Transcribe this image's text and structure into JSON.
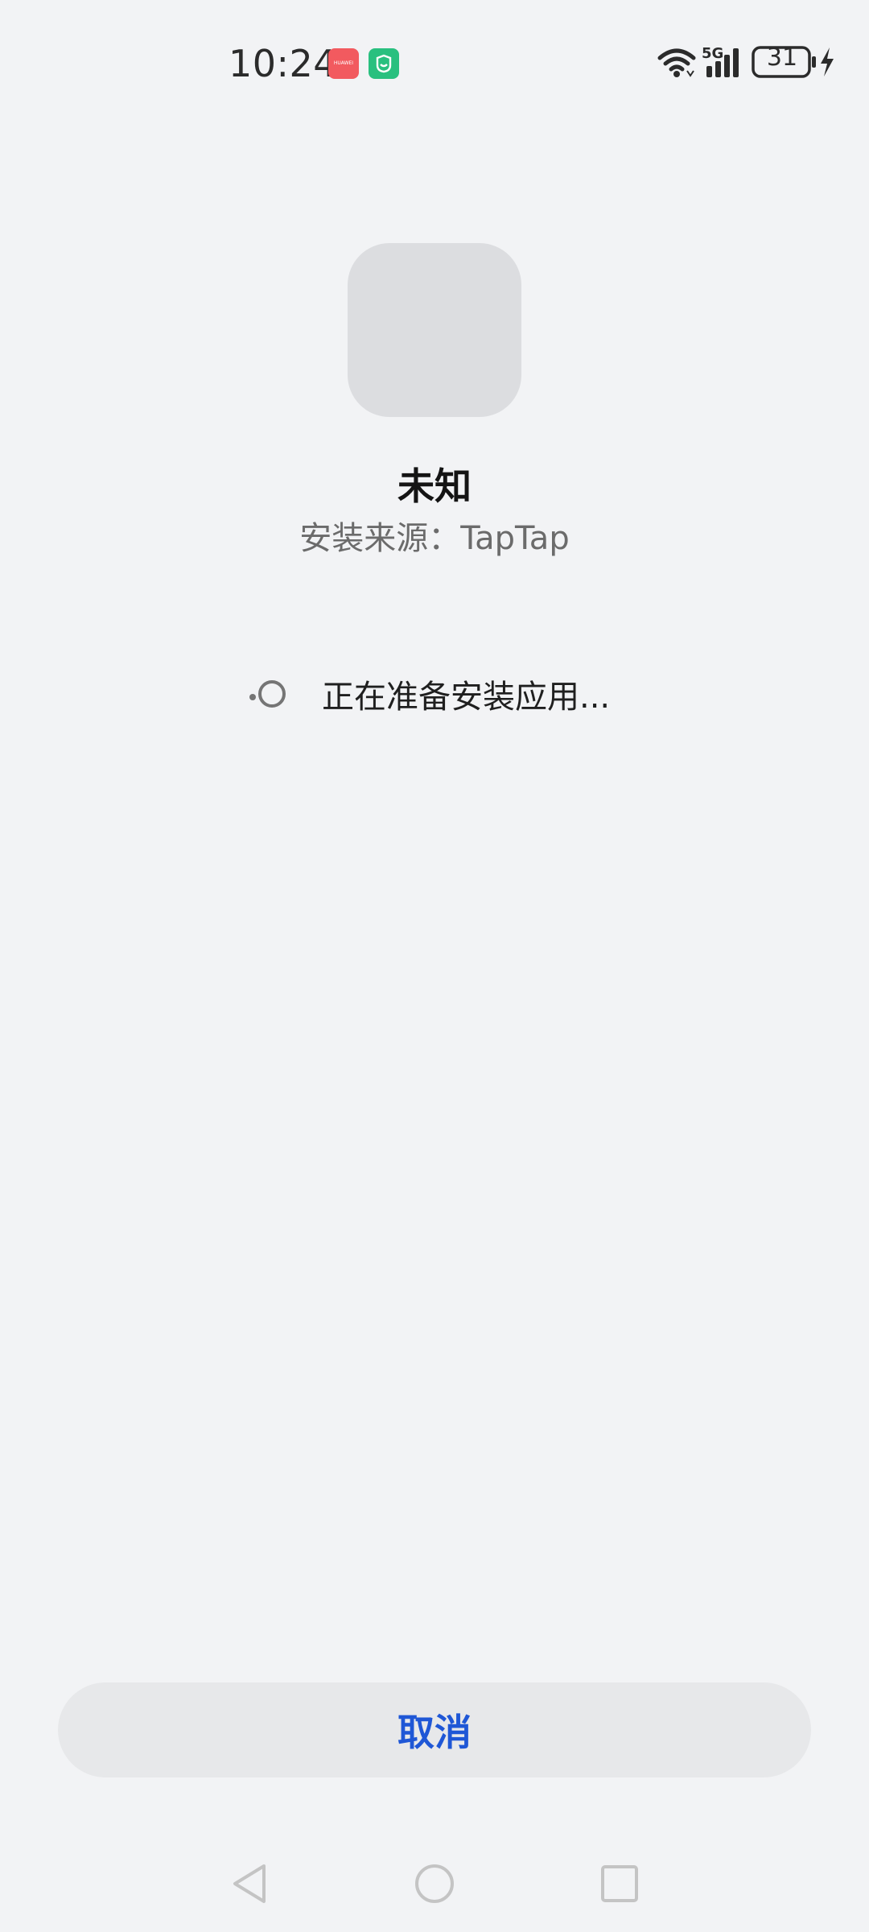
{
  "status_bar": {
    "time": "10:24",
    "network_label": "5G",
    "battery_level": "31",
    "notification_icons": [
      "huawei-appgallery-icon",
      "mi-home-icon"
    ],
    "huawei_label": "HUAWEI"
  },
  "app": {
    "name": "未知",
    "source": "安装来源：TapTap"
  },
  "progress": {
    "text": "正在准备安装应用..."
  },
  "actions": {
    "cancel_label": "取消"
  },
  "colors": {
    "background": "#f2f3f5",
    "accent": "#1f57d6",
    "icon_placeholder": "#dcdde0",
    "button_background": "#e7e8ea"
  }
}
